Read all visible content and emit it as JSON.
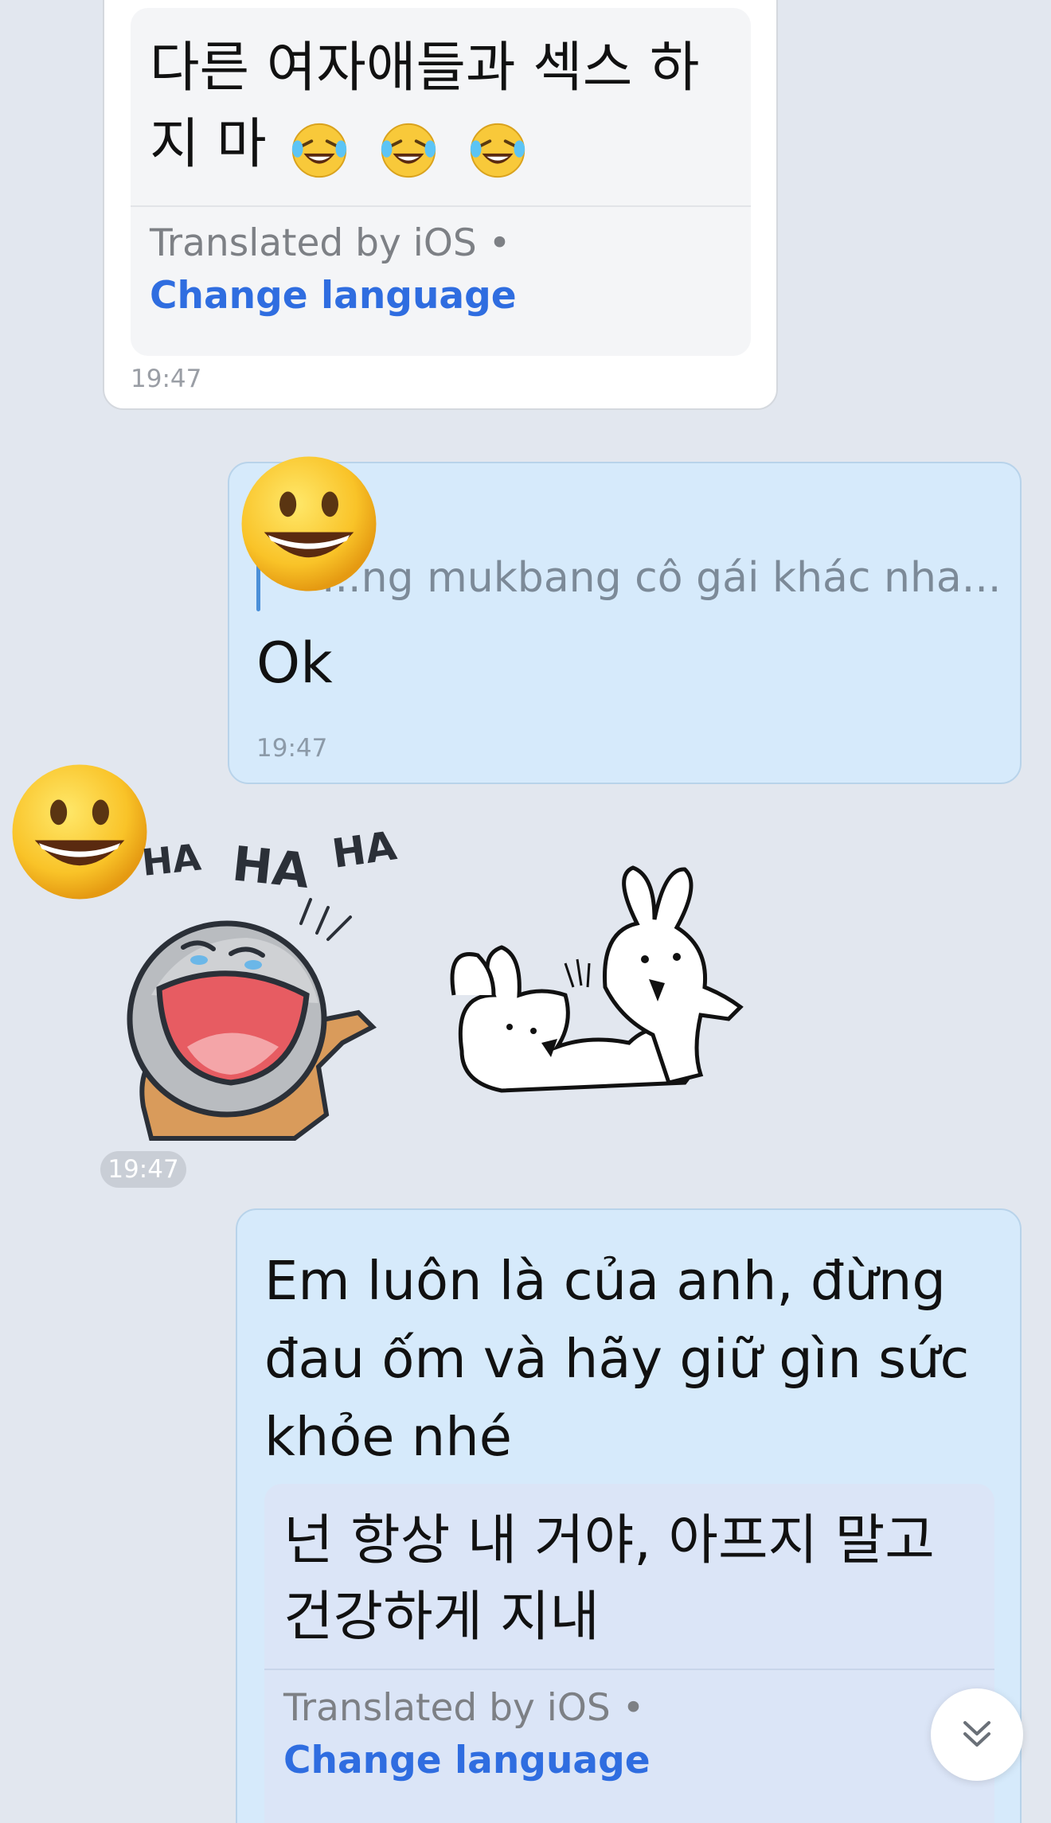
{
  "messages": {
    "incoming_top": {
      "translated_text": "다른 여자애들과 섹스 하지 마",
      "emojis": "🤣🤣🤣",
      "translated_by": "Translated by iOS •",
      "change_language": "Change language",
      "time": "19:47"
    },
    "outgoing_reply": {
      "quoted_text": "...ng mukbang cô gái khác nha...",
      "text": "Ok",
      "time": "19:47",
      "reaction": "😀"
    },
    "stickers": {
      "time": "19:47",
      "reaction": "😀",
      "sticker_1_text": [
        "HA",
        "HA",
        "HA"
      ]
    },
    "outgoing_long": {
      "text": "Em luôn là của anh, đừng đau ốm và hãy giữ gìn sức khỏe nhé",
      "translated_text": "넌 항상 내 거야, 아프지 말고 건강하게 지내",
      "translated_by": "Translated by iOS •",
      "change_language": "Change language"
    }
  },
  "icons": {
    "scroll_down": "double-chevron-down-icon",
    "laugh": "rolling-on-floor-laughing-emoji",
    "smiley": "grinning-face-emoji"
  },
  "colors": {
    "background": "#e2e7ef",
    "incoming_bubble": "#ffffff",
    "outgoing_bubble": "#d6eafb",
    "link": "#2f6de0"
  }
}
